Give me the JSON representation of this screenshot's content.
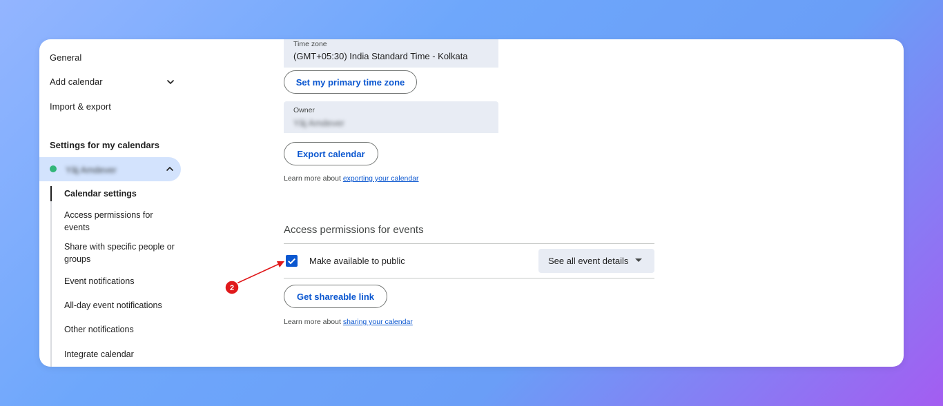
{
  "sidebar": {
    "general": "General",
    "add_calendar": "Add calendar",
    "import_export": "Import & export",
    "section_title": "Settings for my calendars",
    "calendar_name": "Yâj Amdever",
    "sub_items": [
      "Calendar settings",
      "Access permissions for events",
      "Share with specific people or groups",
      "Event notifications",
      "All-day event notifications",
      "Other notifications",
      "Integrate calendar"
    ]
  },
  "main": {
    "timezone": {
      "label": "Time zone",
      "value": "(GMT+05:30) India Standard Time - Kolkata"
    },
    "set_primary_tz_button": "Set my primary time zone",
    "owner": {
      "label": "Owner",
      "value": "Yâj Amdever"
    },
    "export_button": "Export calendar",
    "export_learn": {
      "prefix": "Learn more about ",
      "link": "exporting your calendar"
    },
    "access_section_title": "Access permissions for events",
    "public_checkbox_label": "Make available to public",
    "public_checked": true,
    "visibility_select": "See all event details",
    "shareable_link_button": "Get shareable link",
    "share_learn": {
      "prefix": "Learn more about ",
      "link": "sharing your calendar"
    }
  },
  "annotation": {
    "step": "2"
  },
  "colors": {
    "accent": "#0b57d0",
    "calendar_dot": "#33b679",
    "active_pill": "#d3e3fd",
    "annotation_red": "#e0191b"
  }
}
